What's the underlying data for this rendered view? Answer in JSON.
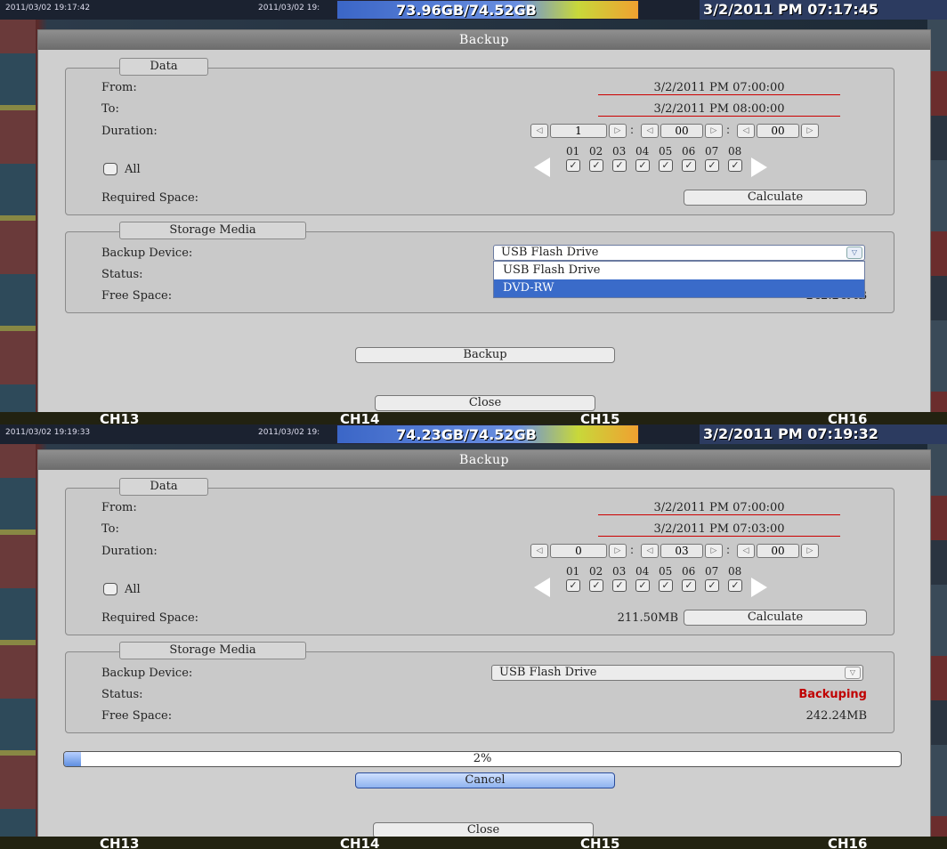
{
  "screens": [
    {
      "topbar": {
        "ts_left": "2011/03/02 19:17:42",
        "ts_mid": "2011/03/02 19:",
        "hdd": "73.96GB/74.52GB",
        "clock": "3/2/2011 PM 07:17:45"
      },
      "dialog": {
        "title": "Backup",
        "data_group": {
          "legend": "Data",
          "from_label": "From:",
          "from_value": "3/2/2011 PM 07:00:00",
          "to_label": "To:",
          "to_value": "3/2/2011 PM 08:00:00",
          "duration_label": "Duration:",
          "duration_h": "1",
          "duration_m": "00",
          "duration_s": "00",
          "all_label": "All",
          "required_space_label": "Required Space:",
          "required_space_value": "",
          "calculate_label": "Calculate"
        },
        "storage_group": {
          "legend": "Storage Media",
          "device_label": "Backup Device:",
          "device_value": "USB Flash Drive",
          "status_label": "Status:",
          "status_value": "",
          "free_label": "Free Space:",
          "free_value": "242.24MB",
          "dropdown_open": true,
          "options": [
            "USB Flash Drive",
            "DVD-RW"
          ]
        },
        "backup_label": "Backup",
        "close_label": "Close"
      },
      "channels": [
        "CH13",
        "CH14",
        "CH15",
        "CH16"
      ]
    },
    {
      "topbar": {
        "ts_left": "2011/03/02 19:19:33",
        "ts_mid": "2011/03/02 19:",
        "hdd": "74.23GB/74.52GB",
        "clock": "3/2/2011 PM 07:19:32"
      },
      "dialog": {
        "title": "Backup",
        "data_group": {
          "legend": "Data",
          "from_label": "From:",
          "from_value": "3/2/2011 PM 07:00:00",
          "to_label": "To:",
          "to_value": "3/2/2011 PM 07:03:00",
          "duration_label": "Duration:",
          "duration_h": "0",
          "duration_m": "03",
          "duration_s": "00",
          "all_label": "All",
          "required_space_label": "Required Space:",
          "required_space_value": "211.50MB",
          "calculate_label": "Calculate"
        },
        "storage_group": {
          "legend": "Storage Media",
          "device_label": "Backup Device:",
          "device_value": "USB Flash Drive",
          "status_label": "Status:",
          "status_value": "Backuping",
          "free_label": "Free Space:",
          "free_value": "242.24MB",
          "dropdown_open": false
        },
        "progress": {
          "label": "2%",
          "fraction": 0.02
        },
        "cancel_label": "Cancel",
        "close_label": "Close"
      },
      "channels": [
        "CH13",
        "CH14",
        "CH15",
        "CH16"
      ]
    }
  ],
  "channel_numbers": [
    "01",
    "02",
    "03",
    "04",
    "05",
    "06",
    "07",
    "08"
  ],
  "colors": {
    "status_red": "#c00000",
    "selected_option": "#3a6bc9",
    "progress_fill": "#5f8fe0"
  }
}
